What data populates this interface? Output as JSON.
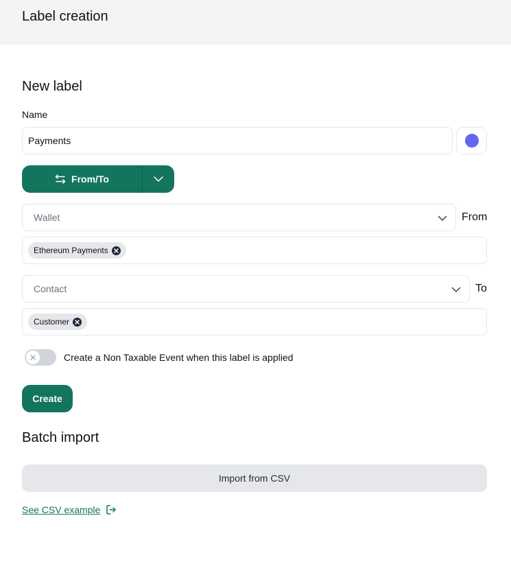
{
  "header": {
    "title": "Label creation"
  },
  "new_label": {
    "title": "New label",
    "name_label": "Name",
    "name_value": "Payments",
    "color": "#6366f1",
    "direction_button": {
      "label": "From/To",
      "icon": "swap-arrows-icon"
    },
    "from": {
      "select_value": "Wallet",
      "side_label": "From",
      "chips": [
        "Ethereum Payments"
      ]
    },
    "to": {
      "select_value": "Contact",
      "side_label": "To",
      "chips": [
        "Customer"
      ]
    },
    "toggle": {
      "label": "Create a Non Taxable Event when this label is applied",
      "on": false
    },
    "create_button": "Create"
  },
  "batch_import": {
    "title": "Batch import",
    "import_button": "Import from CSV",
    "example_link": "See CSV example"
  },
  "colors": {
    "accent": "#14755f",
    "label_color": "#6366f1"
  }
}
